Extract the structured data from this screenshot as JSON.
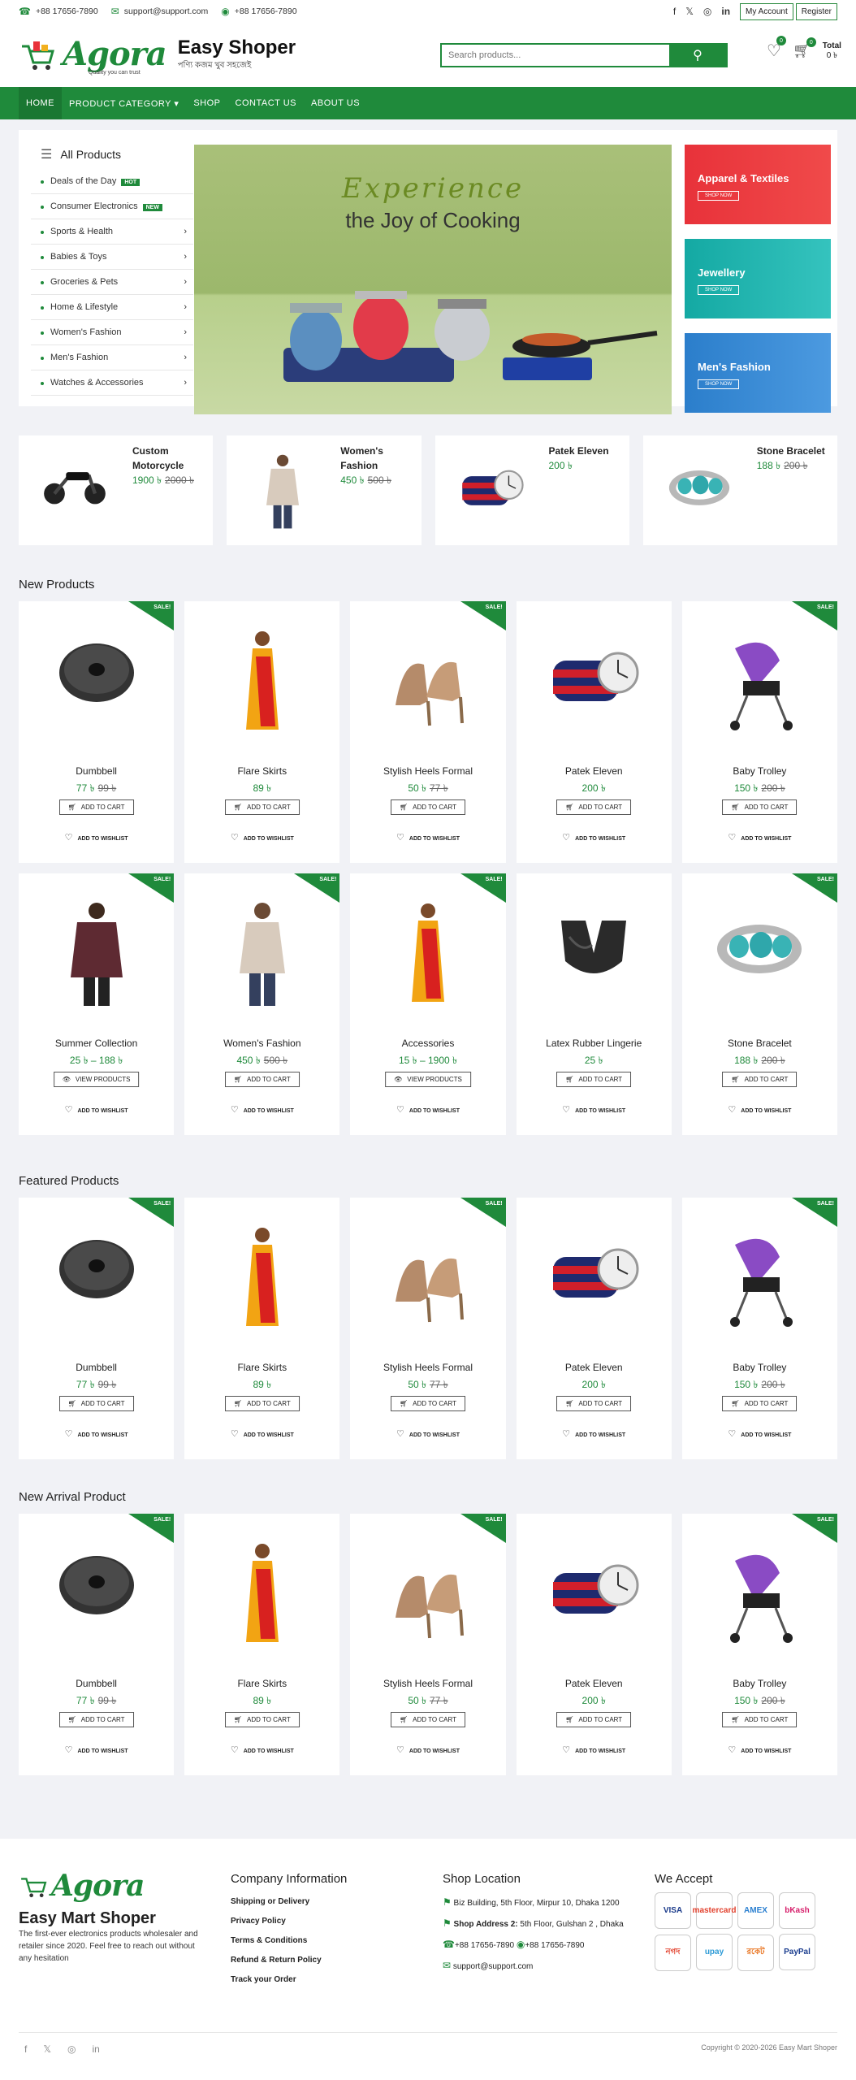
{
  "topbar": {
    "phone": "+88 17656-7890",
    "email": "support@support.com",
    "whatsapp": "+88 17656-7890",
    "social": [
      "f",
      "𝕏",
      "◎",
      "in"
    ],
    "my_account": "My Account",
    "register": "Register"
  },
  "header": {
    "logo": "Agora",
    "logo_sub": "Quality you can trust",
    "brand": "Easy Shoper",
    "tagline": "পণ্যি কজম খুব সহজেই",
    "search_placeholder": "Search products...",
    "wishlist_count": "0",
    "cart_count": "0",
    "cart_total_label": "Total",
    "cart_total_value": "0 ৳"
  },
  "nav": [
    "HOME",
    "PRODUCT CATEGORY ▾",
    "SHOP",
    "CONTACT US",
    "ABOUT US"
  ],
  "categories": {
    "title": "All Products",
    "items": [
      {
        "label": "Deals of the Day",
        "badge": "HOT",
        "arrow": ""
      },
      {
        "label": "Consumer Electronics",
        "badge": "NEW",
        "arrow": ""
      },
      {
        "label": "Sports & Health",
        "badge": "",
        "arrow": "›"
      },
      {
        "label": "Babies & Toys",
        "badge": "",
        "arrow": "›"
      },
      {
        "label": "Groceries & Pets",
        "badge": "",
        "arrow": "›"
      },
      {
        "label": "Home & Lifestyle",
        "badge": "",
        "arrow": "›"
      },
      {
        "label": "Women's Fashion",
        "badge": "",
        "arrow": "›"
      },
      {
        "label": "Men's Fashion",
        "badge": "",
        "arrow": "›"
      },
      {
        "label": "Watches & Accessories",
        "badge": "",
        "arrow": "›"
      }
    ]
  },
  "banner": {
    "title": "Experience",
    "subtitle": "the Joy of Cooking"
  },
  "side_banners": [
    {
      "title": "Apparel & Textiles",
      "cta": "SHOP NOW",
      "color": "#e8323a"
    },
    {
      "title": "Jewellery",
      "cta": "SHOP NOW",
      "color": "#1fb8b2"
    },
    {
      "title": "Men's Fashion",
      "cta": "SHOP NOW",
      "color": "#2b7ecb"
    }
  ],
  "featured_mini": [
    {
      "name": "Custom Motorcycle",
      "price": "1900 ৳",
      "old": "2000 ৳",
      "icon": "motorcycle"
    },
    {
      "name": "Women's Fashion",
      "price": "450 ৳",
      "old": "500 ৳",
      "icon": "woman"
    },
    {
      "name": "Patek Eleven",
      "price": "200 ৳",
      "old": "",
      "icon": "watch"
    },
    {
      "name": "Stone Bracelet",
      "price": "188 ৳",
      "old": "200 ৳",
      "icon": "bracelet"
    }
  ],
  "sections": {
    "new_products": "New Products",
    "featured_products": "Featured Products",
    "new_arrival": "New Arrival Product"
  },
  "labels": {
    "add_to_cart": "ADD TO CART",
    "view_products": "VIEW PRODUCTS",
    "add_to_wishlist": "ADD TO WISHLIST",
    "sale": "SALE!"
  },
  "new_products_row1": [
    {
      "name": "Dumbbell",
      "price": "77 ৳",
      "old": "99 ৳",
      "sale": true,
      "btn": "ADD TO CART",
      "img": "dumbbell"
    },
    {
      "name": "Flare Skirts",
      "price": "89 ৳",
      "old": "",
      "sale": false,
      "btn": "ADD TO CART",
      "img": "saree"
    },
    {
      "name": "Stylish Heels Formal",
      "price": "50 ৳",
      "old": "77 ৳",
      "sale": true,
      "btn": "ADD TO CART",
      "img": "heels"
    },
    {
      "name": "Patek Eleven",
      "price": "200 ৳",
      "old": "",
      "sale": false,
      "btn": "ADD TO CART",
      "img": "watch"
    },
    {
      "name": "Baby Trolley",
      "price": "150 ৳",
      "old": "200 ৳",
      "sale": true,
      "btn": "ADD TO CART",
      "img": "stroller"
    }
  ],
  "new_products_row2": [
    {
      "name": "Summer Collection",
      "price": "25 ৳ – 188 ৳",
      "old": "",
      "sale": true,
      "btn": "VIEW PRODUCTS",
      "img": "woman-dark"
    },
    {
      "name": "Women's Fashion",
      "price": "450 ৳",
      "old": "500 ৳",
      "sale": true,
      "btn": "ADD TO CART",
      "img": "woman"
    },
    {
      "name": "Accessories",
      "price": "15 ৳ – 1900 ৳",
      "old": "",
      "sale": true,
      "btn": "VIEW PRODUCTS",
      "img": "saree"
    },
    {
      "name": "Latex Rubber Lingerie",
      "price": "25 ৳",
      "old": "",
      "sale": false,
      "btn": "ADD TO CART",
      "img": "lingerie"
    },
    {
      "name": "Stone Bracelet",
      "price": "188 ৳",
      "old": "200 ৳",
      "sale": true,
      "btn": "ADD TO CART",
      "img": "bracelet"
    }
  ],
  "footer": {
    "brand": "Easy Mart Shoper",
    "about": "The first-ever electronics products wholesaler and retailer since 2020. Feel free to reach out without any hesitation",
    "company_title": "Company Information",
    "company_links": [
      "Shipping or Delivery",
      "Privacy Policy",
      "Terms & Conditions",
      "Refund & Return Policy",
      "Track your Order"
    ],
    "location_title": "Shop Location",
    "address1": "Biz Building, 5th Floor, Mirpur 10, Dhaka 1200",
    "address2_label": "Shop Address 2:",
    "address2": "5th Floor, Gulshan 2 , Dhaka",
    "phone1": "+88 17656-7890",
    "phone2": "+88 17656-7890",
    "email": "support@support.com",
    "accept_title": "We Accept",
    "payments": [
      "VISA",
      "mastercard",
      "AMEX",
      "bKash",
      "নগদ",
      "upay",
      "রকেট",
      "PayPal"
    ],
    "copyright": "Copyright © 2020-2026 Easy Mart Shoper"
  }
}
